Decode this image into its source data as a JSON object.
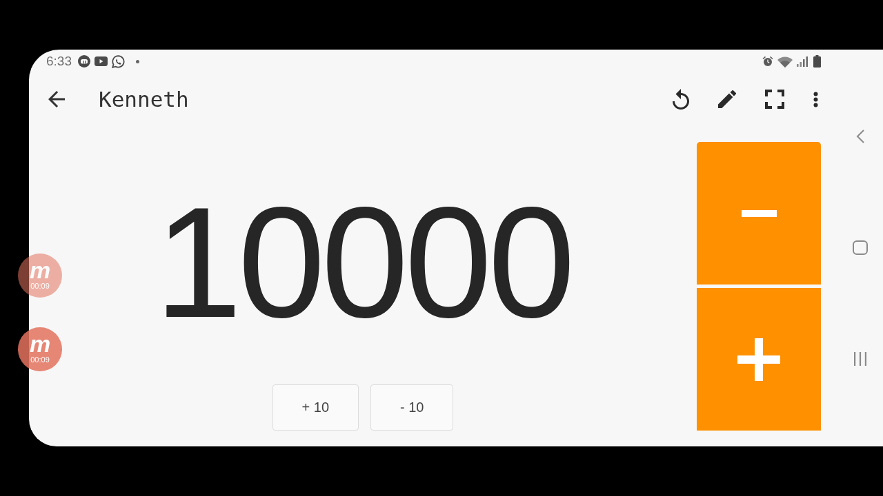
{
  "status_bar": {
    "time": "6:33"
  },
  "app_bar": {
    "title": "Kenneth"
  },
  "counter": {
    "value": "10000"
  },
  "step_buttons": [
    {
      "label": "+ 10"
    },
    {
      "label": "- 10"
    }
  ],
  "side_buttons": [
    {
      "kind": "decrement"
    },
    {
      "kind": "increment"
    }
  ],
  "recorder_bubbles": [
    {
      "logo": "m",
      "timer": "00:09",
      "faded": true
    },
    {
      "logo": "m",
      "timer": "00:09",
      "faded": false
    }
  ]
}
